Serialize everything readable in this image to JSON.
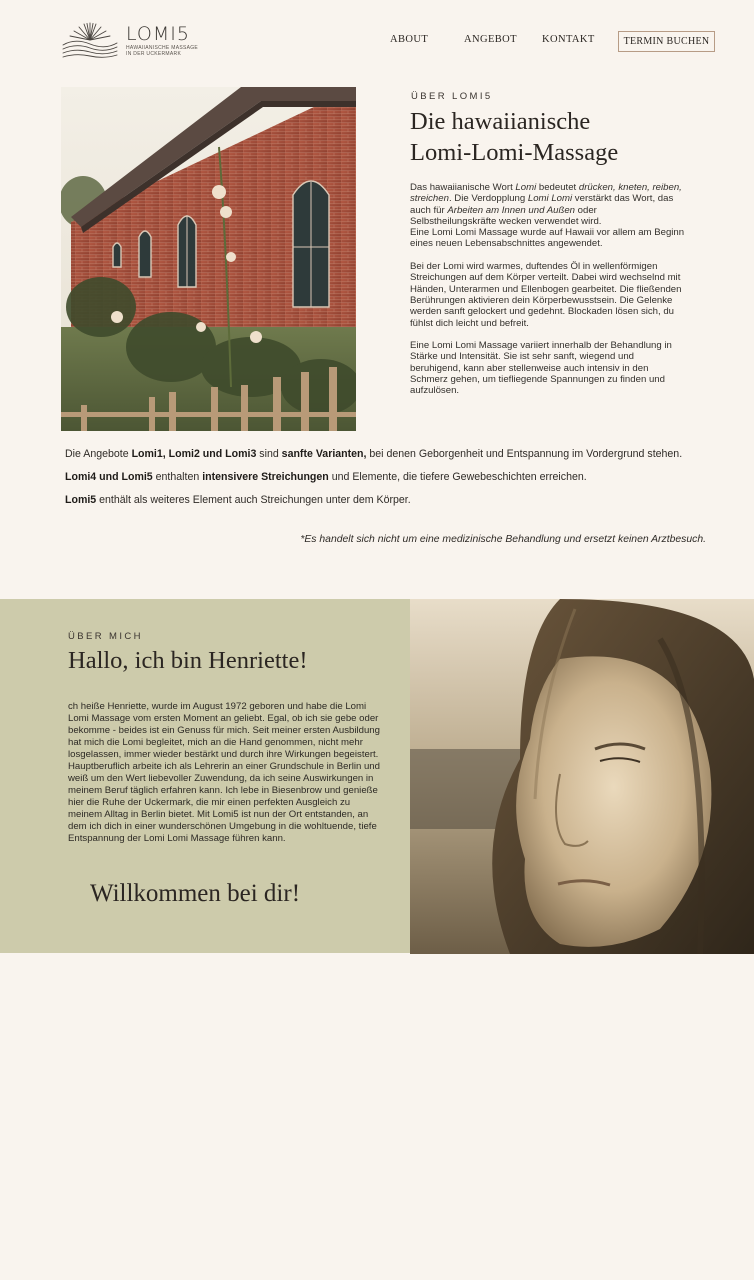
{
  "brand": {
    "name": "LOMI5",
    "tagline_line1": "HAWAIIANISCHE MASSAGE",
    "tagline_line2": "IN DER UCKERMARK"
  },
  "nav": {
    "about": "ABOUT",
    "angebot": "ANGEBOT",
    "kontakt": "KONTAKT",
    "book": "TERMIN BUCHEN"
  },
  "about_lomi": {
    "eyebrow": "ÜBER LOMI5",
    "title_line1": "Die hawaiianische",
    "title_line2": "Lomi-Lomi-Massage",
    "p1": {
      "t1": "Das hawaiianische Wort ",
      "i1": "Lomi",
      "t2": " bedeutet ",
      "i2": "drücken, kneten, reiben, streichen",
      "t3": ". Die Verdopplung ",
      "i3": "Lomi Lomi",
      "t4": " verstärkt das Wort, das auch für ",
      "i4": "Arbeiten am Innen und Außen",
      "t5": " oder Selbstheilungskräfte wecken verwendet wird.",
      "t6": "Eine Lomi Lomi Massage wurde auf Hawaii vor allem am Beginn eines neuen Lebensabschnittes angewendet."
    },
    "p2": "Bei der Lomi wird warmes, duftendes Öl in wellenförmigen Streichungen auf dem Körper verteilt. Dabei wird wechselnd mit Händen, Unterarmen und Ellenbogen gearbeitet. Die fließenden Berührungen aktivieren dein Körperbewusstsein. Die Gelenke werden sanft gelockert und gedehnt. Blockaden lösen sich, du fühlst dich leicht und befreit.",
    "p3": "Eine Lomi Lomi Massage variiert innerhalb der Behandlung in Stärke und Intensität. Sie ist sehr sanft, wiegend und beruhigend, kann aber stellenweise auch intensiv in den Schmerz gehen, um tiefliegende Spannungen zu finden und aufzulösen."
  },
  "angebote": {
    "l1_a": "Die Angebote ",
    "l1_b": "Lomi1, Lomi2 und Lomi3",
    "l1_c": " sind ",
    "l1_d": "sanfte Varianten,",
    "l1_e": " bei denen Geborgenheit und Entspannung im Vordergrund stehen.",
    "l2_a": "Lomi4 und Lomi5",
    "l2_b": " enthalten ",
    "l2_c": "intensivere Streichungen",
    "l2_d": " und Elemente, die tiefere Gewebeschichten erreichen.",
    "l3_a": "Lomi5",
    "l3_b": " enthält als weiteres Element auch Streichungen unter dem Körper."
  },
  "disclaimer": "*Es handelt sich nicht um eine medizinische Behandlung und ersetzt keinen Arztbesuch.",
  "about_me": {
    "eyebrow": "ÜBER MICH",
    "title": "Hallo, ich bin Henriette!",
    "body": "ch heiße Henriette, wurde im August 1972 geboren und habe die Lomi Lomi Massage vom ersten Moment an geliebt. Egal, ob ich sie gebe oder bekomme - beides ist ein Genuss für mich. Seit meiner ersten Ausbildung hat mich die Lomi begleitet, mich an die Hand genommen, nicht mehr losgelassen, immer wieder bestärkt und durch ihre Wirkungen begeistert. Hauptberuflich arbeite ich als Lehrerin an einer Grundschule in Berlin und weiß um den Wert liebevoller Zuwendung, da ich seine Auswirkungen in meinem Beruf täglich erfahren kann. Ich lebe in Biesenbrow und genieße hier die Ruhe der Uckermark, die mir einen perfekten Ausgleich zu meinem Alltag in Berlin bietet. Mit Lomi5 ist nun der Ort entstanden, an dem ich dich in einer wunderschönen Umgebung in die wohltuende, tiefe Entspannung der Lomi Lomi Massage führen kann.",
    "welcome": "Willkommen bei dir!"
  },
  "colors": {
    "page_bg": "#f9f4ee",
    "panel_olive": "#cdcbab",
    "button_border": "#b79c86",
    "text": "#2b2622"
  },
  "icons": {
    "logo_mark": "sunrise-waves-icon"
  }
}
